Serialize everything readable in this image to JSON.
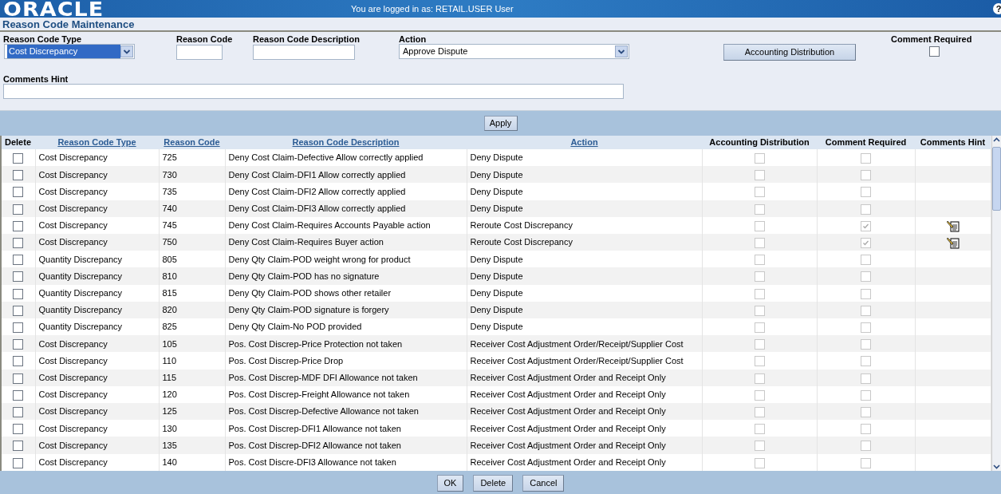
{
  "header": {
    "logo": "ORACLE",
    "login_text": "You are logged in as: RETAIL.USER User",
    "help": "?"
  },
  "page_title": "Reason Code Maintenance",
  "filters": {
    "reason_code_type": {
      "label": "Reason Code Type",
      "value": "Cost Discrepancy"
    },
    "reason_code": {
      "label": "Reason Code"
    },
    "description": {
      "label": "Reason Code Description"
    },
    "action": {
      "label": "Action",
      "value": "Approve Dispute"
    },
    "accounting_button": "Accounting Distribution",
    "comment_required": {
      "label": "Comment Required",
      "checked": false
    },
    "comments_hint": {
      "label": "Comments Hint"
    }
  },
  "apply_button": "Apply",
  "table": {
    "columns": [
      {
        "label": "Delete",
        "sortable": false
      },
      {
        "label": "Reason Code Type",
        "sortable": true
      },
      {
        "label": "Reason Code",
        "sortable": true
      },
      {
        "label": "Reason Code Description",
        "sortable": true
      },
      {
        "label": "Action",
        "sortable": true
      },
      {
        "label": "Accounting Distribution",
        "sortable": false
      },
      {
        "label": "Comment Required",
        "sortable": false
      },
      {
        "label": "Comments Hint",
        "sortable": false
      }
    ],
    "rows": [
      {
        "delete": false,
        "type": "Cost Discrepancy",
        "code": "725",
        "description": "Deny Cost Claim-Defective Allow correctly applied",
        "action": "Deny Dispute",
        "accounting": false,
        "comment_required": false,
        "has_hint": false
      },
      {
        "delete": false,
        "type": "Cost Discrepancy",
        "code": "730",
        "description": "Deny Cost Claim-DFI1 Allow correctly applied",
        "action": "Deny Dispute",
        "accounting": false,
        "comment_required": false,
        "has_hint": false
      },
      {
        "delete": false,
        "type": "Cost Discrepancy",
        "code": "735",
        "description": "Deny Cost Claim-DFI2 Allow correctly applied",
        "action": "Deny Dispute",
        "accounting": false,
        "comment_required": false,
        "has_hint": false
      },
      {
        "delete": false,
        "type": "Cost Discrepancy",
        "code": "740",
        "description": "Deny Cost Claim-DFI3 Allow correctly applied",
        "action": "Deny Dispute",
        "accounting": false,
        "comment_required": false,
        "has_hint": false
      },
      {
        "delete": false,
        "type": "Cost Discrepancy",
        "code": "745",
        "description": "Deny Cost Claim-Requires Accounts Payable action",
        "action": "Reroute Cost Discrepancy",
        "accounting": false,
        "comment_required": true,
        "has_hint": true
      },
      {
        "delete": false,
        "type": "Cost Discrepancy",
        "code": "750",
        "description": "Deny Cost Claim-Requires Buyer action",
        "action": "Reroute Cost Discrepancy",
        "accounting": false,
        "comment_required": true,
        "has_hint": true
      },
      {
        "delete": false,
        "type": "Quantity Discrepancy",
        "code": "805",
        "description": "Deny Qty Claim-POD weight wrong for product",
        "action": "Deny Dispute",
        "accounting": false,
        "comment_required": false,
        "has_hint": false
      },
      {
        "delete": false,
        "type": "Quantity Discrepancy",
        "code": "810",
        "description": "Deny Qty Claim-POD has no signature",
        "action": "Deny Dispute",
        "accounting": false,
        "comment_required": false,
        "has_hint": false
      },
      {
        "delete": false,
        "type": "Quantity Discrepancy",
        "code": "815",
        "description": "Deny Qty Claim-POD shows other retailer",
        "action": "Deny Dispute",
        "accounting": false,
        "comment_required": false,
        "has_hint": false
      },
      {
        "delete": false,
        "type": "Quantity Discrepancy",
        "code": "820",
        "description": "Deny Qty Claim-POD signature is forgery",
        "action": "Deny Dispute",
        "accounting": false,
        "comment_required": false,
        "has_hint": false
      },
      {
        "delete": false,
        "type": "Quantity Discrepancy",
        "code": "825",
        "description": "Deny Qty Claim-No POD provided",
        "action": "Deny Dispute",
        "accounting": false,
        "comment_required": false,
        "has_hint": false
      },
      {
        "delete": false,
        "type": "Cost Discrepancy",
        "code": "105",
        "description": "Pos. Cost Discrep-Price Protection not taken",
        "action": "Receiver Cost Adjustment Order/Receipt/Supplier Cost",
        "accounting": false,
        "comment_required": false,
        "has_hint": false
      },
      {
        "delete": false,
        "type": "Cost Discrepancy",
        "code": "110",
        "description": "Pos. Cost Discrep-Price Drop",
        "action": "Receiver Cost Adjustment Order/Receipt/Supplier Cost",
        "accounting": false,
        "comment_required": false,
        "has_hint": false
      },
      {
        "delete": false,
        "type": "Cost Discrepancy",
        "code": "115",
        "description": "Pos. Cost Discrep-MDF DFI Allowance not taken",
        "action": "Receiver Cost Adjustment Order and Receipt Only",
        "accounting": false,
        "comment_required": false,
        "has_hint": false
      },
      {
        "delete": false,
        "type": "Cost Discrepancy",
        "code": "120",
        "description": "Pos. Cost Discrep-Freight Allowance not taken",
        "action": "Receiver Cost Adjustment Order and Receipt Only",
        "accounting": false,
        "comment_required": false,
        "has_hint": false
      },
      {
        "delete": false,
        "type": "Cost Discrepancy",
        "code": "125",
        "description": "Pos. Cost Discrep-Defective Allowance not taken",
        "action": "Receiver Cost Adjustment Order and Receipt Only",
        "accounting": false,
        "comment_required": false,
        "has_hint": false
      },
      {
        "delete": false,
        "type": "Cost Discrepancy",
        "code": "130",
        "description": "Pos. Cost Discrep-DFI1 Allowance not taken",
        "action": "Receiver Cost Adjustment Order and Receipt Only",
        "accounting": false,
        "comment_required": false,
        "has_hint": false
      },
      {
        "delete": false,
        "type": "Cost Discrepancy",
        "code": "135",
        "description": "Pos. Cost Discrep-DFI2 Allowance not taken",
        "action": "Receiver Cost Adjustment Order and Receipt Only",
        "accounting": false,
        "comment_required": false,
        "has_hint": false
      },
      {
        "delete": false,
        "type": "Cost Discrepancy",
        "code": "140",
        "description": "Pos. Cost Discre-DFI3 Allowance not taken",
        "action": "Receiver Cost Adjustment Order and Receipt Only",
        "accounting": false,
        "comment_required": false,
        "has_hint": false
      }
    ]
  },
  "footer_buttons": [
    "OK",
    "Delete",
    "Cancel"
  ]
}
